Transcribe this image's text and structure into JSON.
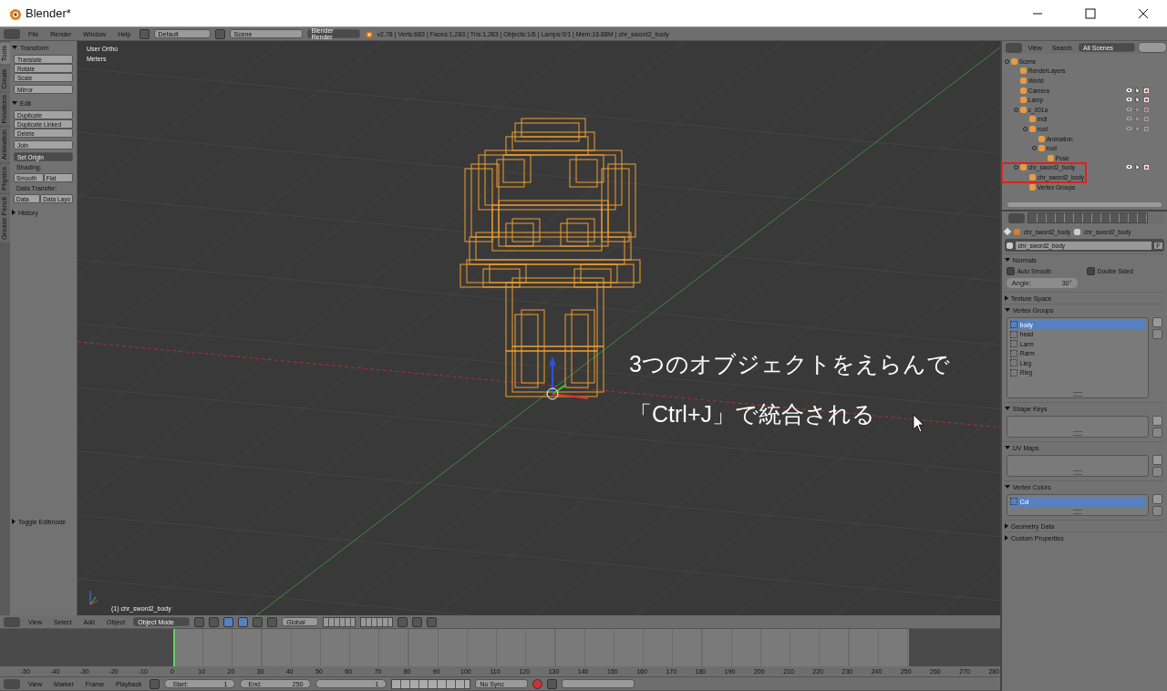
{
  "window": {
    "title": "Blender*"
  },
  "info_header": {
    "menus": [
      "File",
      "Render",
      "Window",
      "Help"
    ],
    "layout": "Default",
    "scene": "Scene",
    "engine": "Blender Render",
    "stats": "v2.78 | Verts:683 | Faces:1,283 | Tris:1,283 | Objects:1/6 | Lamps:0/1 | Mem:16.88M | chr_sword2_body"
  },
  "tool_tabs": [
    {
      "label": "Tools",
      "selected": true
    },
    {
      "label": "Create",
      "selected": false
    },
    {
      "label": "Relations",
      "selected": false
    },
    {
      "label": "Animation",
      "selected": false
    },
    {
      "label": "Physics",
      "selected": false
    },
    {
      "label": "Grease Pencil",
      "selected": false
    }
  ],
  "tool_panel": {
    "sections": [
      {
        "title": "Transform",
        "expanded": true,
        "items": [
          {
            "kind": "stack",
            "labels": [
              "Translate",
              "Rotate",
              "Scale"
            ]
          },
          {
            "kind": "stack",
            "labels": [
              "Mirror"
            ]
          }
        ]
      },
      {
        "title": "Edit",
        "expanded": true,
        "items": [
          {
            "kind": "stack",
            "labels": [
              "Duplicate",
              "Duplicate Linked",
              "Delete"
            ]
          },
          {
            "kind": "stack",
            "labels": [
              "Join"
            ]
          },
          {
            "kind": "dropdown",
            "labels": [
              "Set Origin"
            ]
          },
          {
            "kind": "label",
            "labels": [
              "Shading:"
            ]
          },
          {
            "kind": "row",
            "labels": [
              "Smooth",
              "Flat"
            ]
          },
          {
            "kind": "label",
            "labels": [
              "Data Transfer:"
            ]
          },
          {
            "kind": "row",
            "labels": [
              "Data",
              "Data Layo"
            ]
          }
        ]
      },
      {
        "title": "History",
        "expanded": false
      }
    ],
    "operator": {
      "title": "Toggle Editmode",
      "expanded": false
    }
  },
  "viewport": {
    "view_name": "User Ortho",
    "units": "Meters",
    "object_label": "(1) chr_sword2_body",
    "annotation": [
      "3つのオブジェクトをえらんで",
      "「Ctrl+J」で統合される"
    ]
  },
  "outliner": {
    "menus": [
      "View",
      "Search"
    ],
    "filter": "All Scenes",
    "tree": [
      {
        "name": "Scene",
        "marked": false,
        "children": [
          {
            "name": "RenderLayers",
            "marked": false
          },
          {
            "name": "World",
            "marked": false
          },
          {
            "name": "Camera",
            "marked": false,
            "visible": true
          },
          {
            "name": "Lamp",
            "marked": false,
            "visible": true
          },
          {
            "name": "c_001a",
            "marked": false,
            "visible": false,
            "children": [
              {
                "name": "mdl",
                "marked": false,
                "visible": false
              },
              {
                "name": "root",
                "marked": false,
                "visible": false,
                "children": [
                  {
                    "name": "Animation",
                    "marked": false
                  },
                  {
                    "name": "root",
                    "marked": false,
                    "children": [
                      {
                        "name": "Pose",
                        "marked": false
                      }
                    ]
                  }
                ]
              }
            ]
          },
          {
            "name": "chr_sword2_body",
            "marked": true,
            "visible": true,
            "children": [
              {
                "name": "chr_sword2_body",
                "marked": true
              },
              {
                "name": "Vertex Groups",
                "marked": false
              }
            ]
          }
        ]
      }
    ]
  },
  "properties": {
    "breadcrumb": [
      "chr_sword2_body",
      "chr_sword2_body"
    ],
    "data_name": "chr_sword2_body",
    "fake_user": "F",
    "panels": [
      {
        "kind": "normals",
        "title": "Normals",
        "expanded": true,
        "checkboxes": [
          {
            "label": "Auto Smooth",
            "checked": false
          },
          {
            "label": "Double Sided",
            "checked": false
          }
        ],
        "field": {
          "label": "Angle:",
          "value": "30°",
          "disabled": true
        }
      },
      {
        "kind": "plain",
        "title": "Texture Space",
        "expanded": false
      },
      {
        "kind": "list",
        "title": "Vertex Groups",
        "expanded": true,
        "items": [
          {
            "name": "body",
            "selected": true
          },
          {
            "name": "head",
            "selected": false
          },
          {
            "name": "Larm",
            "selected": false
          },
          {
            "name": "Rarm",
            "selected": false
          },
          {
            "name": "Lleg",
            "selected": false
          },
          {
            "name": "Rleg",
            "selected": false
          }
        ]
      },
      {
        "kind": "list",
        "title": "Shape Keys",
        "expanded": true
      },
      {
        "kind": "list",
        "title": "UV Maps",
        "expanded": true
      },
      {
        "kind": "list",
        "title": "Vertex Colors",
        "expanded": true,
        "items": [
          {
            "name": "Col",
            "selected": true
          }
        ]
      },
      {
        "kind": "plain",
        "title": "Geometry Data",
        "expanded": false
      },
      {
        "kind": "plain",
        "title": "Custom Properties",
        "expanded": false
      }
    ]
  },
  "view3d_header": {
    "menus": [
      "View",
      "Select",
      "Add",
      "Object"
    ],
    "mode": "Object Mode",
    "orientation": "Global"
  },
  "timeline": {
    "ruler": [
      "-50",
      "-40",
      "-30",
      "-20",
      "-10",
      "0",
      "10",
      "20",
      "30",
      "40",
      "50",
      "60",
      "70",
      "80",
      "90",
      "100",
      "110",
      "120",
      "130",
      "140",
      "150",
      "160",
      "170",
      "180",
      "190",
      "200",
      "210",
      "220",
      "230",
      "240",
      "250",
      "260",
      "270",
      "280"
    ]
  },
  "timeline_header": {
    "menus": [
      "View",
      "Marker",
      "Frame",
      "Playback"
    ],
    "start_label": "Start:",
    "start": "1",
    "end_label": "End:",
    "end": "250",
    "current": "1",
    "sync": "No Sync"
  }
}
